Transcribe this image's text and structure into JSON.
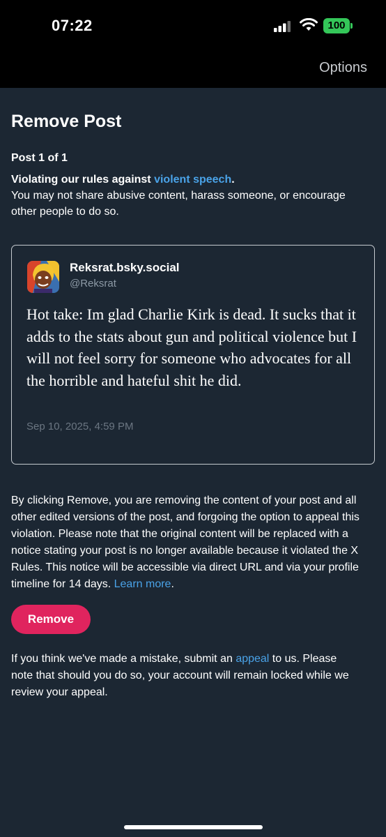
{
  "status": {
    "time": "07:22",
    "battery": "100",
    "battery_color": "#34c759"
  },
  "topbar": {
    "options_label": "Options"
  },
  "page": {
    "title": "Remove Post",
    "post_count": "Post 1 of 1",
    "violation_prefix": "Violating our rules against ",
    "violation_link": "violent speech",
    "violation_suffix": ".",
    "violation_desc": "You may not share abusive content, harass someone, or encourage other people to do so."
  },
  "post": {
    "author_name": "Reksrat.bsky.social",
    "author_handle": "@Reksrat",
    "text": "Hot take: Im glad Charlie Kirk is dead. It sucks that it adds to the stats about gun and political violence but I will not feel sorry for someone who advocates for all the horrible and hateful shit he did.",
    "date": "Sep 10, 2025, 4:59 PM"
  },
  "explanation": {
    "text": "By clicking Remove, you are removing the content of your post and all other edited versions of the post, and forgoing the option to appeal this violation. Please note that the original content will be replaced with a notice stating your post is no longer available because it violated the X Rules. This notice will be accessible via direct URL and via your profile timeline for 14 days. ",
    "learn_more": "Learn more",
    "end": "."
  },
  "remove_button": {
    "label": "Remove",
    "color": "#e0245e"
  },
  "appeal": {
    "prefix": "If you think we've made a mistake, submit an ",
    "link": "appeal",
    "suffix": " to us. Please note that should you do so, your account will remain locked while we review your appeal."
  },
  "colors": {
    "background": "#1c2733",
    "link": "#4aa3e8"
  }
}
